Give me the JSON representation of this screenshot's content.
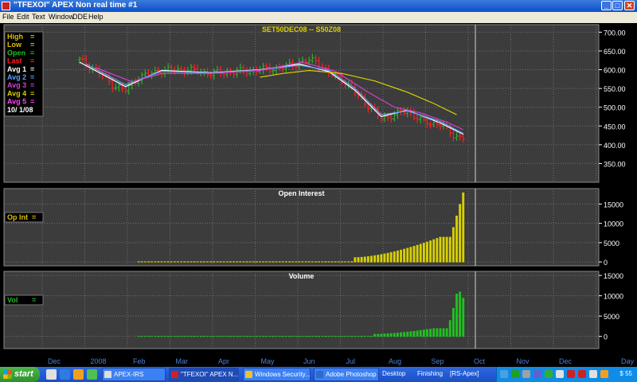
{
  "window": {
    "title": "\"TFEXOI\" APEX Non real time #1",
    "buttons": [
      "_",
      "□",
      "✕"
    ]
  },
  "menu": [
    "File",
    "Edit",
    "Text",
    "Window",
    "DDE",
    "Help"
  ],
  "colors": {
    "panel_bg": "#3c3c3c",
    "grid": "#707070",
    "up_bar": "#2fae2f",
    "down_bar": "#ff2020",
    "avg1": "#ffffff",
    "avg2": "#5aa0ff",
    "avg3": "#d040d0",
    "avg4": "#d8d000",
    "avg5": "#ff40ff",
    "oi_bars": "#d8d000",
    "vol_bars": "#20c020",
    "title_yellow": "#e0d000",
    "axis_text": "#ffffff",
    "month_text": "#4a80d8"
  },
  "legend": [
    {
      "label": "High",
      "value": "=",
      "color": "#e0c000"
    },
    {
      "label": "Low",
      "value": "=",
      "color": "#e0c000"
    },
    {
      "label": "Open",
      "value": "=",
      "color": "#20c020"
    },
    {
      "label": "Last",
      "value": "=",
      "color": "#ff2020"
    },
    {
      "label": "Avg 1",
      "value": "=",
      "color": "#ffffff"
    },
    {
      "label": "Avg 2",
      "value": "=",
      "color": "#5aa0ff"
    },
    {
      "label": "Avg 3",
      "value": "=",
      "color": "#d040d0"
    },
    {
      "label": "Avg 4",
      "value": "=",
      "color": "#d8d000"
    },
    {
      "label": "Avg 5",
      "value": "=",
      "color": "#ff40ff"
    },
    {
      "label": "10/ 1/08",
      "value": "",
      "color": "#ffffff"
    }
  ],
  "oi_legend": {
    "label": "Op Int",
    "value": "="
  },
  "vol_legend": {
    "label": "Vol",
    "value": "="
  },
  "taskbar": {
    "start": "start",
    "tasks": [
      "APEX-IRS",
      "\"TFEXOI\" APEX N...",
      "Windows Security...",
      "Adobe Photoshop"
    ],
    "labels": [
      "Desktop",
      "Finishing",
      "[RS-Apex]"
    ],
    "clock": "$ 55"
  },
  "chart_data": [
    {
      "type": "ohlc",
      "title": "SET50DEC08 -- S50Z08",
      "ylim": [
        300,
        720
      ],
      "yticks": [
        350,
        400,
        450,
        500,
        550,
        600,
        650,
        700
      ],
      "ytick_labels": [
        "350.00",
        "400.00",
        "450.00",
        "500.00",
        "550.00",
        "600.00",
        "650.00",
        "700.00"
      ],
      "x_months": [
        "Dec",
        "2008",
        "Feb",
        "Mar",
        "Apr",
        "May",
        "Jun",
        "Jul",
        "Aug",
        "Sep",
        "Oct",
        "Nov",
        "Dec",
        "Day"
      ],
      "close_path": [
        [
          0,
          625
        ],
        [
          5,
          600
        ],
        [
          10,
          560
        ],
        [
          14,
          545
        ],
        [
          18,
          580
        ],
        [
          25,
          598
        ],
        [
          33,
          600
        ],
        [
          40,
          590
        ],
        [
          48,
          595
        ],
        [
          55,
          600
        ],
        [
          62,
          605
        ],
        [
          67,
          620
        ],
        [
          72,
          625
        ],
        [
          76,
          590
        ],
        [
          80,
          575
        ],
        [
          84,
          540
        ],
        [
          88,
          505
        ],
        [
          92,
          470
        ],
        [
          96,
          480
        ],
        [
          100,
          490
        ],
        [
          105,
          460
        ],
        [
          110,
          455
        ],
        [
          114,
          425
        ],
        [
          117,
          420
        ]
      ],
      "moving_averages": [
        {
          "name": "Avg 1",
          "color": "#ffffff",
          "path": [
            [
              0,
              620
            ],
            [
              14,
              555
            ],
            [
              25,
              598
            ],
            [
              40,
              592
            ],
            [
              55,
              600
            ],
            [
              67,
              615
            ],
            [
              76,
              595
            ],
            [
              84,
              545
            ],
            [
              92,
              475
            ],
            [
              100,
              492
            ],
            [
              110,
              458
            ],
            [
              117,
              428
            ]
          ]
        },
        {
          "name": "Avg 2",
          "color": "#5aa0ff",
          "path": [
            [
              2,
              615
            ],
            [
              14,
              560
            ],
            [
              25,
              596
            ],
            [
              40,
              591
            ],
            [
              55,
              599
            ],
            [
              67,
              612
            ],
            [
              76,
              598
            ],
            [
              84,
              550
            ],
            [
              92,
              480
            ],
            [
              100,
              490
            ],
            [
              110,
              462
            ],
            [
              117,
              430
            ]
          ]
        },
        {
          "name": "Avg 3",
          "color": "#d040d0",
          "path": [
            [
              5,
              605
            ],
            [
              16,
              568
            ],
            [
              25,
              590
            ],
            [
              40,
              590
            ],
            [
              55,
              598
            ],
            [
              68,
              620
            ],
            [
              78,
              596
            ],
            [
              88,
              540
            ],
            [
              96,
              500
            ],
            [
              104,
              485
            ],
            [
              112,
              460
            ],
            [
              117,
              440
            ]
          ]
        },
        {
          "name": "Avg 4",
          "color": "#d8d000",
          "path": [
            [
              55,
              580
            ],
            [
              62,
              590
            ],
            [
              70,
              598
            ],
            [
              80,
              590
            ],
            [
              90,
              570
            ],
            [
              100,
              540
            ],
            [
              108,
              510
            ],
            [
              115,
              480
            ]
          ]
        }
      ]
    },
    {
      "type": "bar",
      "title": "Open Interest",
      "ylim": [
        -1000,
        19000
      ],
      "yticks": [
        0,
        5000,
        10000,
        15000
      ],
      "ytick_labels": [
        "0",
        "5000",
        "10000",
        "15000"
      ],
      "shape": {
        "start_index": 18,
        "end_index": 117,
        "flat_value": 150,
        "ramp_start_index": 84,
        "ramp_start_value": 1200,
        "late_index": 110,
        "late_value": 6500,
        "last_values": [
          9000,
          12000,
          15000,
          18000
        ]
      }
    },
    {
      "type": "bar",
      "title": "Volume",
      "ylim": [
        -3000,
        16000
      ],
      "yticks": [
        0,
        5000,
        10000,
        15000
      ],
      "ytick_labels": [
        "0",
        "5000",
        "10000",
        "15000"
      ],
      "shape": {
        "start_index": 18,
        "end_index": 117,
        "flat_value": 120,
        "ramp_start_index": 90,
        "ramp_start_value": 600,
        "late_index": 108,
        "late_value": 2000,
        "last_values": [
          4000,
          7000,
          10500,
          11000,
          9500
        ]
      }
    }
  ]
}
